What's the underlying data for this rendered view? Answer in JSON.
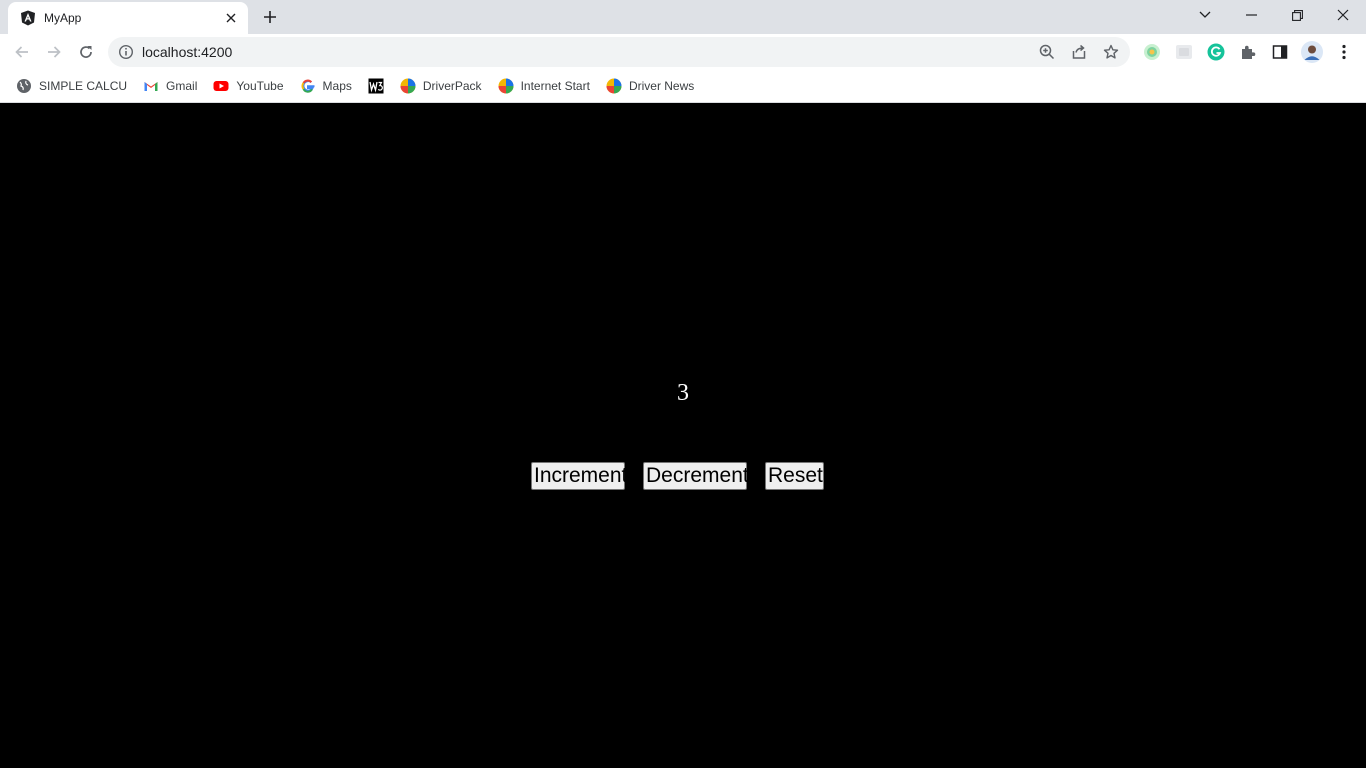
{
  "browser": {
    "tab": {
      "title": "MyApp",
      "favicon": "angular-icon"
    },
    "address": {
      "url": "localhost:4200"
    },
    "bookmarks": [
      {
        "label": "SIMPLE CALCU",
        "icon": "globe-icon"
      },
      {
        "label": "Gmail",
        "icon": "gmail-icon"
      },
      {
        "label": "YouTube",
        "icon": "youtube-icon"
      },
      {
        "label": "Maps",
        "icon": "google-icon"
      },
      {
        "label": "",
        "icon": "w3schools-icon"
      },
      {
        "label": "DriverPack",
        "icon": "driverpack-icon"
      },
      {
        "label": "Internet Start",
        "icon": "driverpack-icon"
      },
      {
        "label": "Driver News",
        "icon": "driverpack-icon"
      }
    ]
  },
  "app": {
    "count": "3",
    "buttons": {
      "increment": "Increment",
      "decrement": "Decrement",
      "reset": "Reset"
    }
  },
  "colors": {
    "page_background": "#000000",
    "tabstrip": "#dee1e6",
    "omnibox": "#f1f3f4"
  }
}
